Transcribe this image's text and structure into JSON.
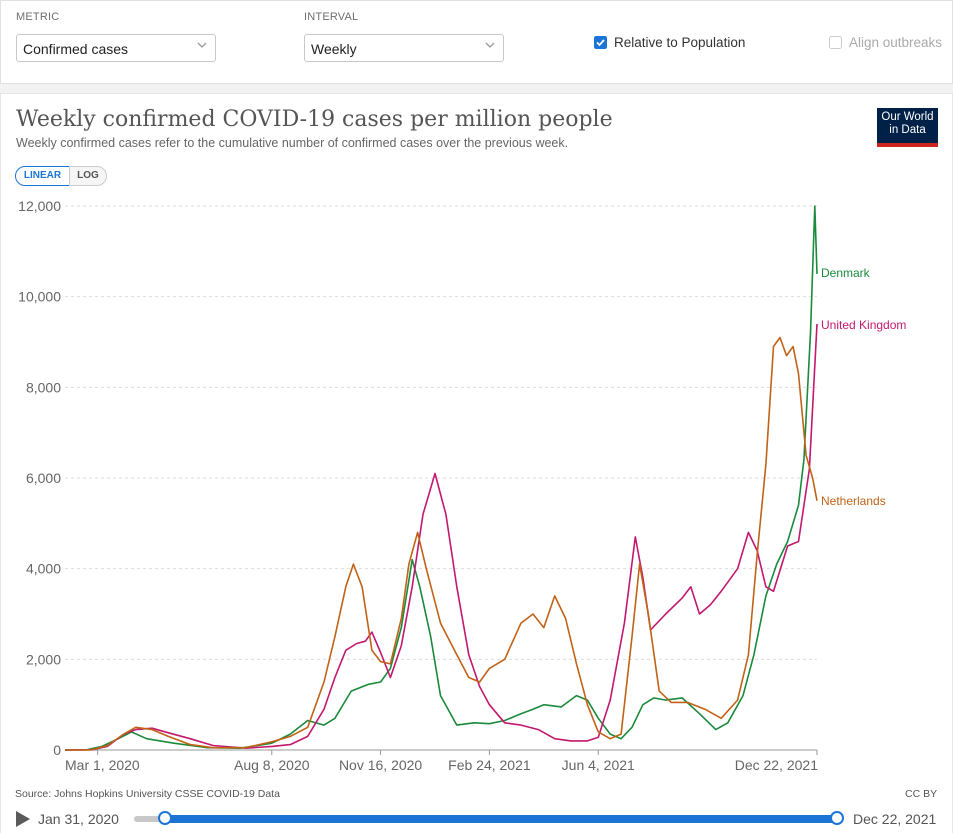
{
  "controls": {
    "metric_label": "METRIC",
    "metric_value": "Confirmed cases",
    "interval_label": "INTERVAL",
    "interval_value": "Weekly",
    "relative_label": "Relative to Population",
    "relative_checked": true,
    "align_label": "Align outbreaks",
    "align_checked": false
  },
  "header": {
    "title": "Weekly confirmed COVID-19 cases per million people",
    "subtitle": "Weekly confirmed cases refer to the cumulative number of confirmed cases over the previous week.",
    "logo_line1": "Our World",
    "logo_line2": "in Data"
  },
  "scale": {
    "linear_label": "LINEAR",
    "log_label": "LOG",
    "selected": "linear"
  },
  "footer": {
    "source": "Source: Johns Hopkins University CSSE COVID-19 Data",
    "license": "CC BY"
  },
  "timeline": {
    "start_label": "Jan 31, 2020",
    "end_label": "Dec 22, 2021",
    "start_fraction": 0.0,
    "end_fraction": 1.0
  },
  "colors": {
    "accent": "#1c75d6",
    "logo_bg": "#002147",
    "logo_bar": "#ce261e"
  },
  "chart_data": {
    "type": "line",
    "title": "Weekly confirmed COVID-19 cases per million people",
    "ylim": [
      0,
      12000
    ],
    "y_ticks": [
      0,
      2000,
      4000,
      6000,
      8000,
      10000,
      12000
    ],
    "y_tick_labels": [
      "0",
      "2,000",
      "4,000",
      "6,000",
      "8,000",
      "10,000",
      "12,000"
    ],
    "x_range": [
      "2020-01-31",
      "2021-12-22"
    ],
    "x_ticks": [
      "2020-03-01",
      "2020-08-08",
      "2020-11-16",
      "2021-02-24",
      "2021-06-04",
      "2021-12-22"
    ],
    "x_tick_labels": [
      "Mar 1, 2020",
      "Aug 8, 2020",
      "Nov 16, 2020",
      "Feb 24, 2021",
      "Jun 4, 2021",
      "Dec 22, 2021"
    ],
    "grid": true,
    "legend": "line-end labels",
    "series": [
      {
        "name": "Denmark",
        "color": "#1a8a3c",
        "points": [
          [
            "2020-01-31",
            0
          ],
          [
            "2020-02-20",
            5
          ],
          [
            "2020-03-05",
            80
          ],
          [
            "2020-03-20",
            250
          ],
          [
            "2020-04-01",
            400
          ],
          [
            "2020-04-15",
            250
          ],
          [
            "2020-05-10",
            150
          ],
          [
            "2020-06-10",
            50
          ],
          [
            "2020-07-10",
            40
          ],
          [
            "2020-08-08",
            150
          ],
          [
            "2020-08-25",
            350
          ],
          [
            "2020-09-10",
            650
          ],
          [
            "2020-09-25",
            550
          ],
          [
            "2020-10-05",
            700
          ],
          [
            "2020-10-20",
            1300
          ],
          [
            "2020-11-05",
            1450
          ],
          [
            "2020-11-16",
            1500
          ],
          [
            "2020-11-25",
            1800
          ],
          [
            "2020-12-05",
            2700
          ],
          [
            "2020-12-15",
            4200
          ],
          [
            "2020-12-22",
            3600
          ],
          [
            "2021-01-01",
            2500
          ],
          [
            "2021-01-10",
            1200
          ],
          [
            "2021-01-25",
            550
          ],
          [
            "2021-02-10",
            600
          ],
          [
            "2021-02-24",
            580
          ],
          [
            "2021-03-10",
            650
          ],
          [
            "2021-03-25",
            800
          ],
          [
            "2021-04-05",
            900
          ],
          [
            "2021-04-15",
            1000
          ],
          [
            "2021-05-01",
            950
          ],
          [
            "2021-05-15",
            1200
          ],
          [
            "2021-05-25",
            1100
          ],
          [
            "2021-06-04",
            700
          ],
          [
            "2021-06-15",
            350
          ],
          [
            "2021-06-25",
            250
          ],
          [
            "2021-07-05",
            500
          ],
          [
            "2021-07-15",
            1000
          ],
          [
            "2021-07-25",
            1150
          ],
          [
            "2021-08-05",
            1100
          ],
          [
            "2021-08-20",
            1150
          ],
          [
            "2021-09-05",
            800
          ],
          [
            "2021-09-20",
            450
          ],
          [
            "2021-10-01",
            600
          ],
          [
            "2021-10-15",
            1200
          ],
          [
            "2021-10-25",
            2100
          ],
          [
            "2021-11-05",
            3400
          ],
          [
            "2021-11-15",
            4100
          ],
          [
            "2021-11-25",
            4600
          ],
          [
            "2021-12-05",
            5400
          ],
          [
            "2021-12-10",
            6400
          ],
          [
            "2021-12-16",
            9200
          ],
          [
            "2021-12-20",
            12000
          ],
          [
            "2021-12-22",
            10500
          ]
        ]
      },
      {
        "name": "United Kingdom",
        "color": "#c2186f",
        "points": [
          [
            "2020-01-31",
            0
          ],
          [
            "2020-02-25",
            5
          ],
          [
            "2020-03-10",
            80
          ],
          [
            "2020-03-25",
            350
          ],
          [
            "2020-04-05",
            450
          ],
          [
            "2020-04-20",
            480
          ],
          [
            "2020-05-05",
            380
          ],
          [
            "2020-05-25",
            250
          ],
          [
            "2020-06-15",
            100
          ],
          [
            "2020-07-15",
            40
          ],
          [
            "2020-08-08",
            80
          ],
          [
            "2020-08-25",
            120
          ],
          [
            "2020-09-10",
            300
          ],
          [
            "2020-09-25",
            900
          ],
          [
            "2020-10-05",
            1600
          ],
          [
            "2020-10-15",
            2200
          ],
          [
            "2020-10-25",
            2350
          ],
          [
            "2020-11-02",
            2400
          ],
          [
            "2020-11-08",
            2600
          ],
          [
            "2020-11-16",
            2150
          ],
          [
            "2020-11-25",
            1600
          ],
          [
            "2020-12-05",
            2300
          ],
          [
            "2020-12-15",
            3600
          ],
          [
            "2020-12-25",
            5200
          ],
          [
            "2021-01-05",
            6100
          ],
          [
            "2021-01-15",
            5200
          ],
          [
            "2021-01-25",
            3600
          ],
          [
            "2021-02-05",
            2100
          ],
          [
            "2021-02-15",
            1400
          ],
          [
            "2021-02-24",
            1000
          ],
          [
            "2021-03-10",
            600
          ],
          [
            "2021-03-25",
            550
          ],
          [
            "2021-04-10",
            450
          ],
          [
            "2021-04-25",
            250
          ],
          [
            "2021-05-10",
            200
          ],
          [
            "2021-05-25",
            200
          ],
          [
            "2021-06-04",
            280
          ],
          [
            "2021-06-15",
            1100
          ],
          [
            "2021-06-28",
            2800
          ],
          [
            "2021-07-08",
            4700
          ],
          [
            "2021-07-15",
            3800
          ],
          [
            "2021-07-22",
            2650
          ],
          [
            "2021-08-05",
            3000
          ],
          [
            "2021-08-20",
            3350
          ],
          [
            "2021-08-28",
            3600
          ],
          [
            "2021-09-05",
            3000
          ],
          [
            "2021-09-15",
            3200
          ],
          [
            "2021-09-25",
            3500
          ],
          [
            "2021-10-10",
            4000
          ],
          [
            "2021-10-20",
            4800
          ],
          [
            "2021-10-28",
            4400
          ],
          [
            "2021-11-05",
            3600
          ],
          [
            "2021-11-12",
            3500
          ],
          [
            "2021-11-25",
            4500
          ],
          [
            "2021-12-05",
            4600
          ],
          [
            "2021-12-15",
            6200
          ],
          [
            "2021-12-22",
            9400
          ]
        ]
      },
      {
        "name": "Netherlands",
        "color": "#c16218",
        "points": [
          [
            "2020-01-31",
            0
          ],
          [
            "2020-02-25",
            5
          ],
          [
            "2020-03-10",
            100
          ],
          [
            "2020-03-25",
            350
          ],
          [
            "2020-04-05",
            500
          ],
          [
            "2020-04-20",
            450
          ],
          [
            "2020-05-05",
            300
          ],
          [
            "2020-05-25",
            120
          ],
          [
            "2020-06-15",
            50
          ],
          [
            "2020-07-15",
            50
          ],
          [
            "2020-08-08",
            180
          ],
          [
            "2020-08-25",
            300
          ],
          [
            "2020-09-10",
            500
          ],
          [
            "2020-09-25",
            1500
          ],
          [
            "2020-10-05",
            2500
          ],
          [
            "2020-10-15",
            3600
          ],
          [
            "2020-10-22",
            4100
          ],
          [
            "2020-10-30",
            3600
          ],
          [
            "2020-11-08",
            2200
          ],
          [
            "2020-11-16",
            1950
          ],
          [
            "2020-11-25",
            1900
          ],
          [
            "2020-12-05",
            2900
          ],
          [
            "2020-12-12",
            4100
          ],
          [
            "2020-12-20",
            4800
          ],
          [
            "2020-12-28",
            4000
          ],
          [
            "2021-01-10",
            2800
          ],
          [
            "2021-01-25",
            2100
          ],
          [
            "2021-02-05",
            1600
          ],
          [
            "2021-02-15",
            1500
          ],
          [
            "2021-02-24",
            1800
          ],
          [
            "2021-03-10",
            2000
          ],
          [
            "2021-03-25",
            2800
          ],
          [
            "2021-04-05",
            3000
          ],
          [
            "2021-04-15",
            2700
          ],
          [
            "2021-04-25",
            3400
          ],
          [
            "2021-05-05",
            2900
          ],
          [
            "2021-05-15",
            1900
          ],
          [
            "2021-05-25",
            1000
          ],
          [
            "2021-06-04",
            400
          ],
          [
            "2021-06-15",
            250
          ],
          [
            "2021-06-25",
            350
          ],
          [
            "2021-07-05",
            2500
          ],
          [
            "2021-07-12",
            4100
          ],
          [
            "2021-07-20",
            3000
          ],
          [
            "2021-07-30",
            1300
          ],
          [
            "2021-08-10",
            1050
          ],
          [
            "2021-08-25",
            1050
          ],
          [
            "2021-09-10",
            900
          ],
          [
            "2021-09-25",
            700
          ],
          [
            "2021-10-10",
            1100
          ],
          [
            "2021-10-20",
            2100
          ],
          [
            "2021-10-28",
            4300
          ],
          [
            "2021-11-05",
            6300
          ],
          [
            "2021-11-12",
            8900
          ],
          [
            "2021-11-18",
            9100
          ],
          [
            "2021-11-24",
            8700
          ],
          [
            "2021-11-30",
            8900
          ],
          [
            "2021-12-05",
            8300
          ],
          [
            "2021-12-12",
            6500
          ],
          [
            "2021-12-18",
            6000
          ],
          [
            "2021-12-22",
            5500
          ]
        ]
      }
    ]
  }
}
